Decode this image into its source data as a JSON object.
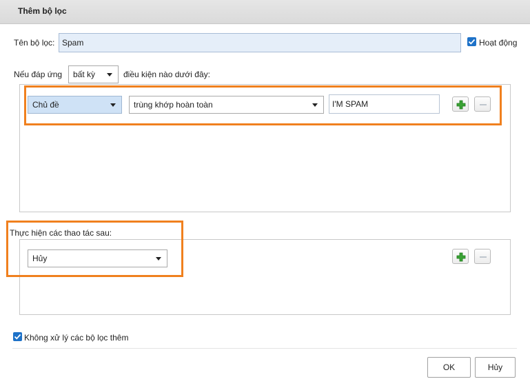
{
  "dialog": {
    "title": "Thêm bộ lọc"
  },
  "filter_name": {
    "label": "Tên bộ lọc:",
    "value": "Spam"
  },
  "active": {
    "label": "Hoạt động",
    "checked": true
  },
  "match": {
    "prefix": "Nếu đáp ứng",
    "mode": "bất kỳ",
    "suffix": "điều kiện nào dưới đây:"
  },
  "conditions": [
    {
      "field": "Chủ đề",
      "operator": "trùng khớp hoàn toàn",
      "value": "I'M SPAM"
    }
  ],
  "actions_label": "Thực hiện các thao tác sau:",
  "actions": [
    {
      "action": "Hủy"
    }
  ],
  "stop_processing": {
    "label": "Không xử lý các bộ lọc thêm",
    "checked": true
  },
  "buttons": {
    "ok": "OK",
    "cancel": "Hủy"
  },
  "colors": {
    "highlight": "#f0801e",
    "accent": "#1e72c8",
    "add_green": "#3aa335"
  }
}
